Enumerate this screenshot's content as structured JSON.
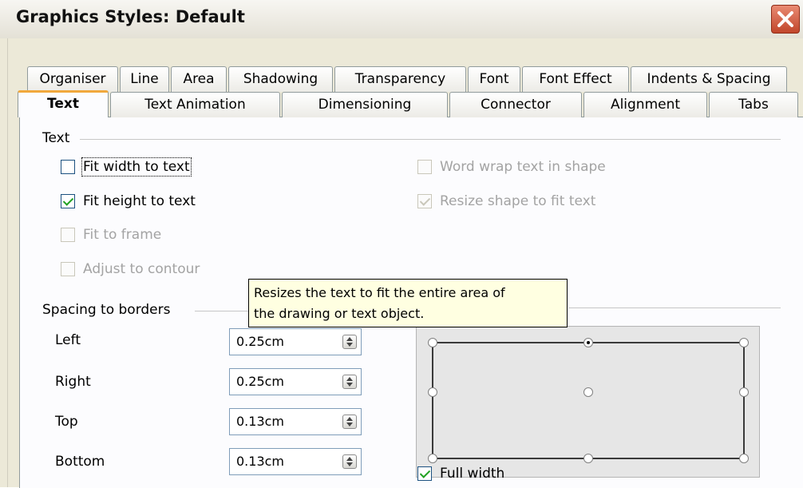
{
  "window": {
    "title": "Graphics Styles: Default"
  },
  "tabs_row1": [
    "Organiser",
    "Line",
    "Area",
    "Shadowing",
    "Transparency",
    "Font",
    "Font Effect",
    "Indents & Spacing"
  ],
  "tabs_row2": [
    "Text",
    "Text Animation",
    "Dimensioning",
    "Connector",
    "Alignment",
    "Tabs"
  ],
  "active_tab": "Text",
  "text_section": {
    "heading": "Text",
    "fit_width": {
      "label": "Fit width to text",
      "checked": false,
      "enabled": true
    },
    "fit_height": {
      "label": "Fit height to text",
      "checked": true,
      "enabled": true
    },
    "fit_frame": {
      "label": "Fit to frame",
      "checked": false,
      "enabled": false
    },
    "adjust_contour": {
      "label": "Adjust to contour",
      "checked": false,
      "enabled": false
    },
    "word_wrap": {
      "label": "Word wrap text in shape",
      "checked": false,
      "enabled": false
    },
    "resize_shape": {
      "label": "Resize shape to fit text",
      "checked": true,
      "enabled": false
    }
  },
  "spacing_section": {
    "heading": "Spacing to borders",
    "left": {
      "label": "Left",
      "value": "0.25cm"
    },
    "right": {
      "label": "Right",
      "value": "0.25cm"
    },
    "top": {
      "label": "Top",
      "value": "0.13cm"
    },
    "bottom": {
      "label": "Bottom",
      "value": "0.13cm"
    }
  },
  "anchor_section": {
    "selected_anchor": "top-center",
    "full_width": {
      "label": "Full width",
      "checked": true
    }
  },
  "tooltip": {
    "line1": "Resizes the text to fit the entire area of",
    "line2": "the drawing or text object."
  },
  "colors": {
    "tab_highlight": "#f1a83c",
    "check_green": "#21a121",
    "tooltip_bg": "#ffffe1",
    "dialog_bg": "#ece9d8"
  }
}
